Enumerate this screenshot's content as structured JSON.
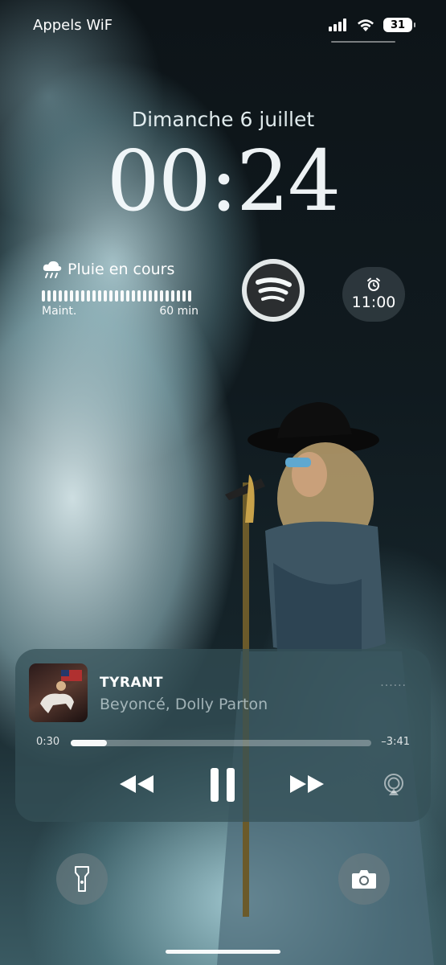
{
  "status_bar": {
    "carrier": "Appels WiF",
    "battery": "31",
    "icons": [
      "cellular-signal-icon",
      "wifi-icon",
      "battery-icon"
    ]
  },
  "lock_screen": {
    "date": "Dimanche 6 juillet",
    "time": "00:24"
  },
  "widgets": {
    "weather": {
      "icon": "cloud-rain-icon",
      "title": "Pluie en cours",
      "start_label": "Maint.",
      "end_label": "60 min"
    },
    "spotify": {
      "icon": "spotify-logo-icon"
    },
    "alarm": {
      "icon": "alarm-clock-icon",
      "time": "11:00"
    }
  },
  "now_playing": {
    "title": "TYRANT",
    "artist": "Beyoncé, Dolly Parton",
    "elapsed": "0:30",
    "remaining": "–3:41",
    "progress_fraction": 0.12,
    "controls": [
      "rewind-icon",
      "pause-icon",
      "fast-forward-icon",
      "airplay-icon"
    ]
  },
  "quick_actions": [
    "flashlight-icon",
    "camera-icon"
  ],
  "colors": {
    "player_bg": "#34505a",
    "accent": "#ffffff"
  }
}
